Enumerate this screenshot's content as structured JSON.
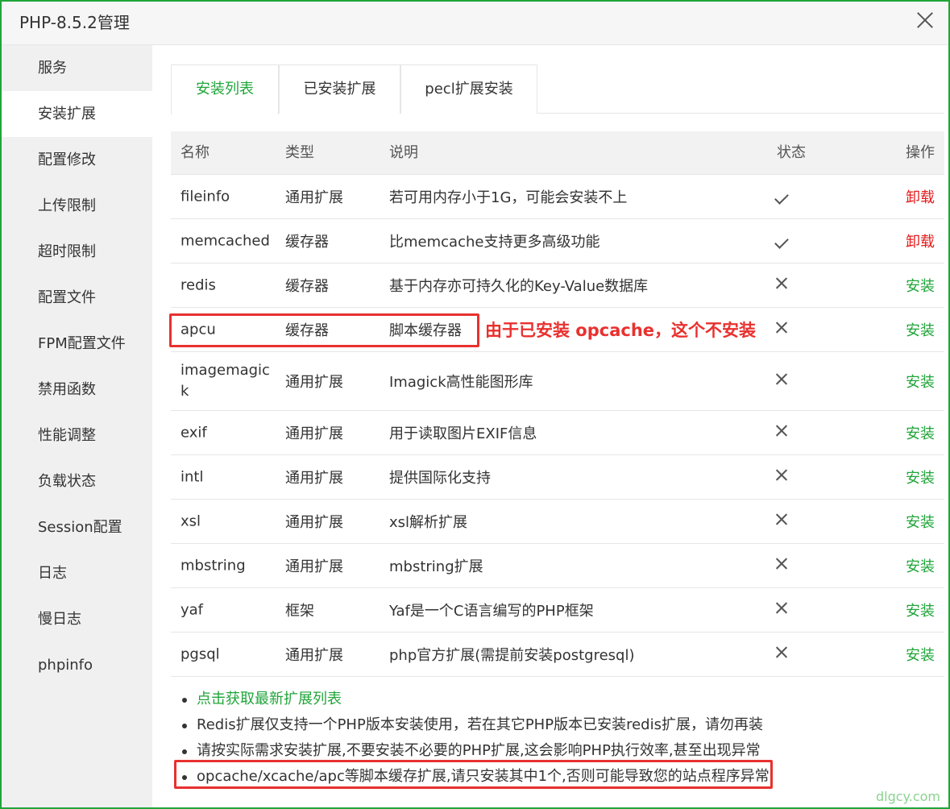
{
  "window": {
    "title": "PHP-8.5.2管理"
  },
  "sidebar": {
    "items": [
      {
        "label": "服务"
      },
      {
        "label": "安装扩展"
      },
      {
        "label": "配置修改"
      },
      {
        "label": "上传限制"
      },
      {
        "label": "超时限制"
      },
      {
        "label": "配置文件"
      },
      {
        "label": "FPM配置文件"
      },
      {
        "label": "禁用函数"
      },
      {
        "label": "性能调整"
      },
      {
        "label": "负载状态"
      },
      {
        "label": "Session配置"
      },
      {
        "label": "日志"
      },
      {
        "label": "慢日志"
      },
      {
        "label": "phpinfo"
      }
    ],
    "active_index": 1
  },
  "tabs": [
    {
      "label": "安装列表"
    },
    {
      "label": "已安装扩展"
    },
    {
      "label": "pecl扩展安装"
    }
  ],
  "table": {
    "headers": {
      "name": "名称",
      "type": "类型",
      "desc": "说明",
      "status": "状态",
      "op": "操作"
    },
    "rows": [
      {
        "name": "fileinfo",
        "type": "通用扩展",
        "desc": "若可用内存小于1G，可能会安装不上",
        "installed": true,
        "op": "卸载"
      },
      {
        "name": "memcached",
        "type": "缓存器",
        "desc": "比memcache支持更多高级功能",
        "installed": true,
        "op": "卸载"
      },
      {
        "name": "redis",
        "type": "缓存器",
        "desc": "基于内存亦可持久化的Key-Value数据库",
        "installed": false,
        "op": "安装"
      },
      {
        "name": "apcu",
        "type": "缓存器",
        "desc": "脚本缓存器",
        "installed": false,
        "op": "安装"
      },
      {
        "name": "imagemagick",
        "type": "通用扩展",
        "desc": "Imagick高性能图形库",
        "installed": false,
        "op": "安装"
      },
      {
        "name": "exif",
        "type": "通用扩展",
        "desc": "用于读取图片EXIF信息",
        "installed": false,
        "op": "安装"
      },
      {
        "name": "intl",
        "type": "通用扩展",
        "desc": "提供国际化支持",
        "installed": false,
        "op": "安装"
      },
      {
        "name": "xsl",
        "type": "通用扩展",
        "desc": "xsl解析扩展",
        "installed": false,
        "op": "安装"
      },
      {
        "name": "mbstring",
        "type": "通用扩展",
        "desc": "mbstring扩展",
        "installed": false,
        "op": "安装"
      },
      {
        "name": "yaf",
        "type": "框架",
        "desc": "Yaf是一个C语言编写的PHP框架",
        "installed": false,
        "op": "安装"
      },
      {
        "name": "pgsql",
        "type": "通用扩展",
        "desc": "php官方扩展(需提前安装postgresql)",
        "installed": false,
        "op": "安装"
      }
    ]
  },
  "annotation": {
    "text": "由于已安装 opcache，这个不安装"
  },
  "notes": [
    "点击获取最新扩展列表",
    "Redis扩展仅支持一个PHP版本安装使用，若在其它PHP版本已安装redis扩展，请勿再装",
    "请按实际需求安装扩展,不要安装不必要的PHP扩展,这会影响PHP执行效率,甚至出现异常",
    "opcache/xcache/apc等脚本缓存扩展,请只安装其中1个,否则可能导致您的站点程序异常"
  ],
  "watermark": "dlgcy.com",
  "colors": {
    "accent": "#20a53a",
    "danger": "#e31c1c",
    "annotation": "#e8312f"
  }
}
